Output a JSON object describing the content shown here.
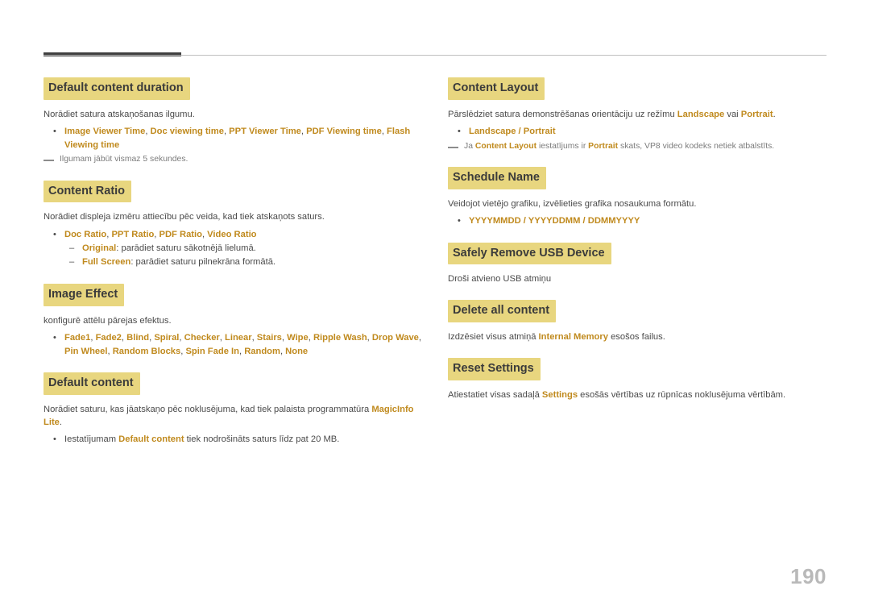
{
  "page": {
    "number": "190"
  },
  "left_column": [
    {
      "heading": "Default content duration",
      "intro": "Norādiet satura atskaņošanas ilgumu.",
      "bullets_html": [
        "<b class=\"k\">Image Viewer Time</b>, <b class=\"k\">Doc viewing time</b>, <b class=\"k\">PPT Viewer Time</b>, <b class=\"k\">PDF Viewing time</b>, <b class=\"k\">Flash Viewing time</b>"
      ],
      "note_html": "Ilgumam jābūt vismaz 5 sekundes."
    },
    {
      "heading": "Content Ratio",
      "intro": "Norādiet displeja izmēru attiecību pēc veida, kad tiek atskaņots saturs.",
      "bullets_html": [
        "<b class=\"k\">Doc Ratio</b>, <b class=\"k\">PPT Ratio</b>, <b class=\"k\">PDF Ratio</b>, <b class=\"k\">Video Ratio</b>"
      ],
      "sub_html": [
        "<b class=\"k\">Original</b>: parādiet saturu sākotnējā lielumā.",
        "<b class=\"k\">Full Screen</b>: parādiet saturu pilnekrāna formātā."
      ]
    },
    {
      "heading": "Image Effect",
      "intro": "konfigurē attēlu pārejas efektus.",
      "bullets_html": [
        "<b class=\"k\">Fade1</b>, <b class=\"k\">Fade2</b>, <b class=\"k\">Blind</b>, <b class=\"k\">Spiral</b>, <b class=\"k\">Checker</b>, <b class=\"k\">Linear</b>, <b class=\"k\">Stairs</b>, <b class=\"k\">Wipe</b>, <b class=\"k\">Ripple Wash</b>, <b class=\"k\">Drop Wave</b>, <b class=\"k\">Pin Wheel</b>, <b class=\"k\">Random Blocks</b>, <b class=\"k\">Spin Fade In</b>, <b class=\"k\">Random</b>, <b class=\"k\">None</b>"
      ]
    },
    {
      "heading": "Default content",
      "intro_html": "Norādiet saturu, kas jāatskaņo pēc noklusējuma, kad tiek palaista programmatūra <b class=\"k\">MagicInfo Lite</b>.",
      "bullets_html": [
        "Iestatījumam <b class=\"k\">Default content</b> tiek nodrošināts saturs līdz pat 20 MB."
      ]
    }
  ],
  "right_column": [
    {
      "heading": "Content Layout",
      "intro_html": "Pārslēdziet satura demonstrēšanas orientāciju uz režīmu <b class=\"k\">Landscape</b> vai <b class=\"k\">Portrait</b>.",
      "bullets_html": [
        "<b class=\"k\">Landscape / Portrait</b>"
      ],
      "note_html": "Ja <b class=\"k\">Content Layout</b> iestatījums ir <b class=\"k\">Portrait</b> skats, VP8 video kodeks netiek atbalstīts."
    },
    {
      "heading": "Schedule Name",
      "intro": "Veidojot vietējo grafiku, izvēlieties grafika nosaukuma formātu.",
      "bullets_html": [
        "<b class=\"k\">YYYYMMDD / YYYYDDMM / DDMMYYYY</b>"
      ]
    },
    {
      "heading": "Safely Remove USB Device",
      "intro": "Droši atvieno USB atmiņu"
    },
    {
      "heading": "Delete all content",
      "intro_html": "Izdzēsiet visus atmiņā <b class=\"k\">Internal Memory</b> esošos failus."
    },
    {
      "heading": "Reset Settings",
      "intro_html": "Atiestatiet visas sadaļā <b class=\"k\">Settings</b> esošās vērtības uz rūpnīcas noklusējuma vērtībām."
    }
  ]
}
